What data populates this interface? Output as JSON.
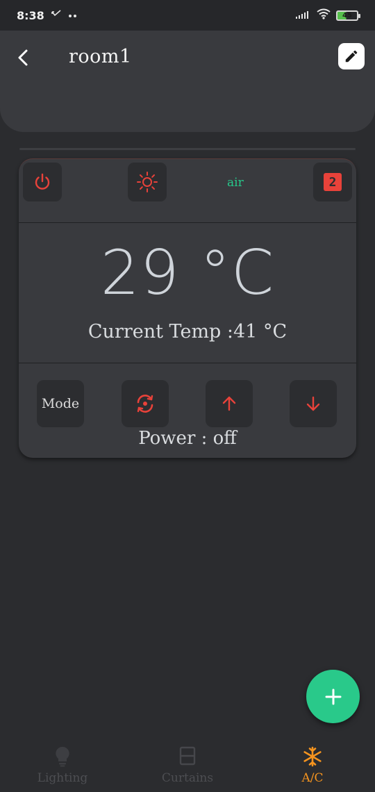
{
  "status_bar": {
    "time": "8:38",
    "battery": "45",
    "icons": [
      "notification-check-icon",
      "more-dots-icon",
      "signal-icon",
      "wifi-icon",
      "battery-icon"
    ]
  },
  "header": {
    "title": "room1",
    "back_icon": "chevron-left-icon",
    "edit_icon": "pencil-icon"
  },
  "ac_card": {
    "power_icon": "power-icon",
    "brightness_icon": "sun-icon",
    "air_label": "air",
    "fan_badge": "2",
    "set_temp": "29 °C",
    "current_temp": "Current Temp :41 °C",
    "mode_label": "Mode",
    "swing_icon": "swing-rotate-icon",
    "temp_up_icon": "arrow-up-icon",
    "temp_down_icon": "arrow-down-icon",
    "power_status": "Power : off",
    "accent_color": "#e8423a",
    "air_color": "#27c98b"
  },
  "fab": {
    "icon": "plus-icon",
    "color": "#29c98a"
  },
  "bottom_nav": {
    "items": [
      {
        "label": "Lighting",
        "icon": "bulb-icon",
        "active": false
      },
      {
        "label": "Curtains",
        "icon": "curtain-icon",
        "active": false
      },
      {
        "label": "A/C",
        "icon": "snowflake-icon",
        "active": true
      }
    ],
    "active_color": "#f5941f"
  }
}
